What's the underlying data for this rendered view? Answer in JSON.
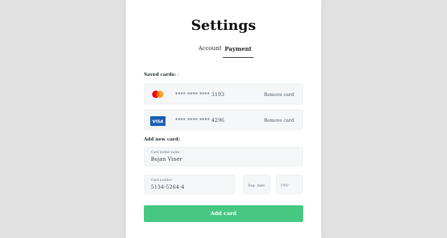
{
  "page": {
    "title": "Settings"
  },
  "tabs": [
    {
      "label": "Account"
    },
    {
      "label": "Payment"
    }
  ],
  "saved_cards": {
    "label": "Saved cards:",
    "suffix": ":",
    "items": [
      {
        "brand": "mastercard",
        "number": "**** **** **** 3193",
        "action": "Remove card"
      },
      {
        "brand": "visa",
        "number": "**** **** **** 4296",
        "action": "Remove card",
        "brand_text": "VISA"
      }
    ]
  },
  "new_card": {
    "label": "Add new card:",
    "holder_label": "Card holder name",
    "holder_value": "Bojan Viner",
    "number_label": "Card number",
    "number_value": "5134-5264-4",
    "exp_placeholder": "Exp. date",
    "cvv_placeholder": "CVV"
  },
  "button": {
    "label": "Add card"
  },
  "colors": {
    "accent": "#46c882",
    "visa_blue": "#1a5fb4",
    "mc_red": "#eb001b",
    "mc_orange": "#f79e1b"
  }
}
